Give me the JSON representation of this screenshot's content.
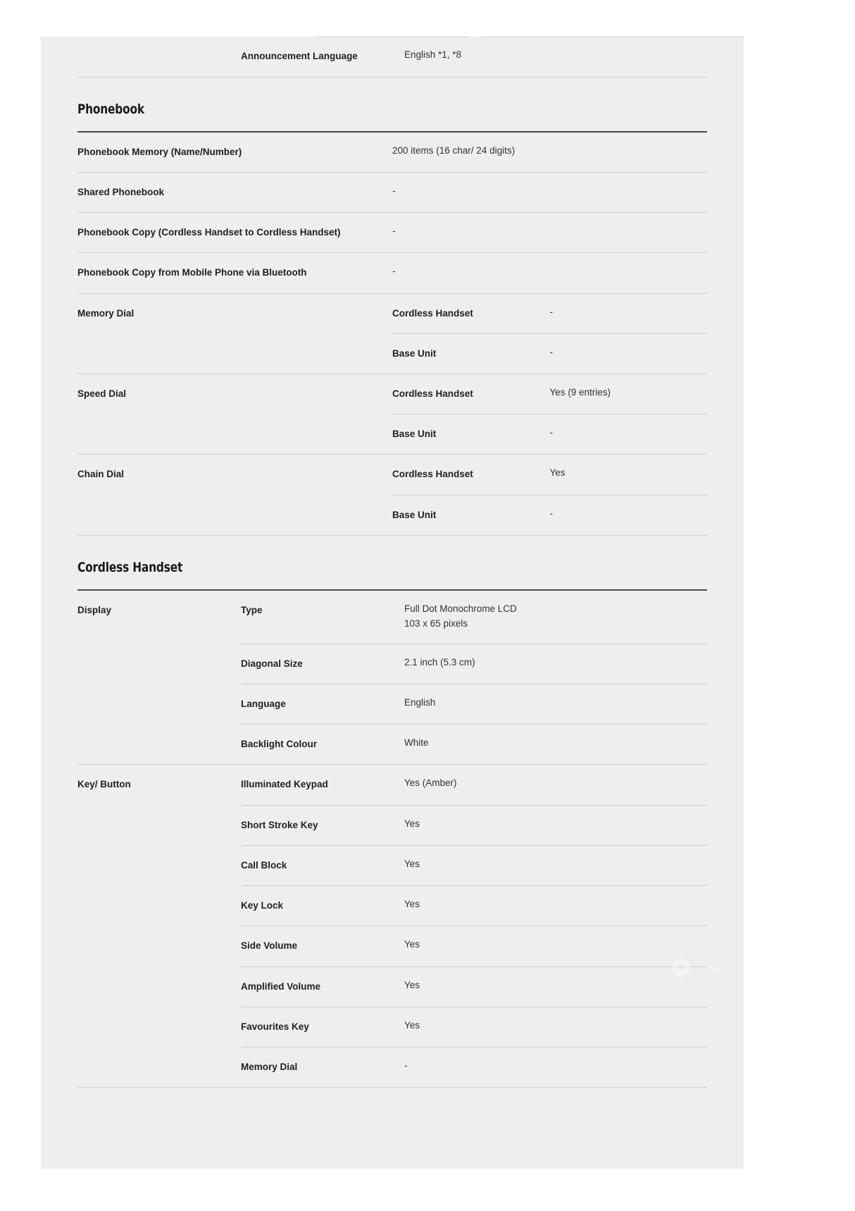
{
  "page": {
    "background_color": "#ffffff",
    "panel_color": "#eeeeee",
    "rule_color": "#cfcfcf",
    "heading_rule_color": "#4a4a4a"
  },
  "top_partial_row": {
    "label": "Announcement Language",
    "value": "English *1, *8"
  },
  "sections": [
    {
      "heading": "Phonebook",
      "rows": [
        {
          "col1": "Phonebook Memory (Name/Number)",
          "col2": "200 items (16 char/ 24 digits)",
          "col3": null,
          "two_col": true
        },
        {
          "col1": "Shared Phonebook",
          "col2": "-",
          "col3": null,
          "two_col": true
        },
        {
          "col1": "Phonebook Copy (Cordless Handset to Cordless Handset)",
          "col2": "-",
          "col3": null,
          "two_col": true
        },
        {
          "col1": "Phonebook Copy from Mobile Phone via Bluetooth",
          "col2": "-",
          "col3": null,
          "two_col": true
        },
        {
          "col1": "Memory Dial",
          "col2": "Cordless Handset",
          "col3": "-",
          "two_col": false,
          "group_start": true
        },
        {
          "col1": "",
          "col2": "Base Unit",
          "col3": "-",
          "two_col": false,
          "group_end": true
        },
        {
          "col1": "Speed Dial",
          "col2": "Cordless Handset",
          "col3": "Yes (9 entries)",
          "two_col": false,
          "group_start": true
        },
        {
          "col1": "",
          "col2": "Base Unit",
          "col3": "-",
          "two_col": false,
          "group_end": true
        },
        {
          "col1": "Chain Dial",
          "col2": "Cordless Handset",
          "col3": "Yes",
          "two_col": false,
          "group_start": true
        },
        {
          "col1": "",
          "col2": "Base Unit",
          "col3": "-",
          "two_col": false,
          "group_end": true
        }
      ]
    },
    {
      "heading": "Cordless Handset",
      "rows": [
        {
          "col1": "Display",
          "col2": "Type",
          "col3": "Full Dot Monochrome LCD\n103 x 65 pixels",
          "two_col": false,
          "group_start": true
        },
        {
          "col1": "",
          "col2": "Diagonal Size",
          "col3": "2.1 inch (5.3 cm)",
          "two_col": false
        },
        {
          "col1": "",
          "col2": "Language",
          "col3": "English",
          "two_col": false
        },
        {
          "col1": "",
          "col2": "Backlight Colour",
          "col3": "White",
          "two_col": false,
          "group_end": true
        },
        {
          "col1": "Key/ Button",
          "col2": "Illuminated Keypad",
          "col3": "Yes (Amber)",
          "two_col": false,
          "group_start": true
        },
        {
          "col1": "",
          "col2": "Short Stroke Key",
          "col3": "Yes",
          "two_col": false
        },
        {
          "col1": "",
          "col2": "Call Block",
          "col3": "Yes",
          "two_col": false
        },
        {
          "col1": "",
          "col2": "Key Lock",
          "col3": "Yes",
          "two_col": false
        },
        {
          "col1": "",
          "col2": "Side Volume",
          "col3": "Yes",
          "two_col": false
        },
        {
          "col1": "",
          "col2": "Amplified Volume",
          "col3": "Yes",
          "two_col": false
        },
        {
          "col1": "",
          "col2": "Favourites Key",
          "col3": "Yes",
          "two_col": false
        },
        {
          "col1": "",
          "col2": "Memory Dial",
          "col3": "-",
          "two_col": false,
          "last": true
        }
      ]
    }
  ],
  "chat_widget": {
    "icon": "chat-bubble-icon",
    "label": "Chat"
  }
}
